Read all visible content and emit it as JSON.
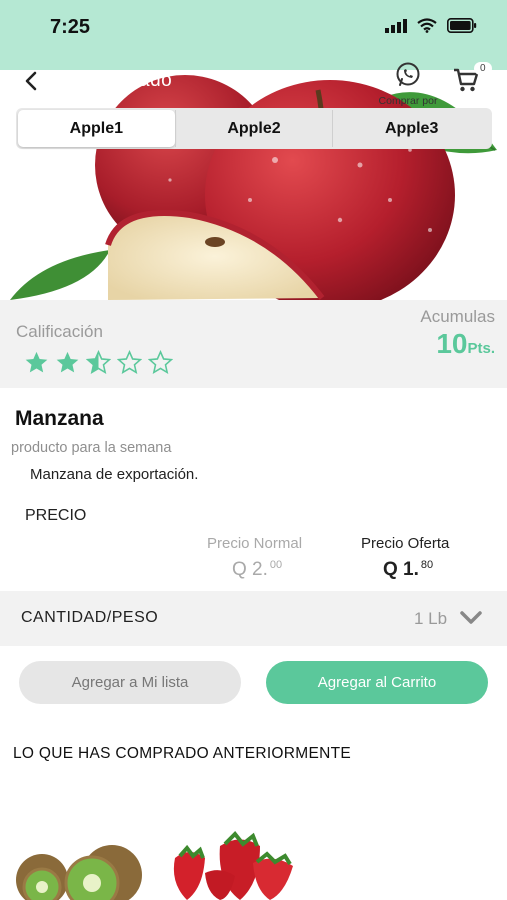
{
  "status_bar": {
    "time": "7:25"
  },
  "header": {
    "title": "Mi mercado",
    "whatsapp_label": "Comprar por",
    "cart_count": "0"
  },
  "tabs": [
    {
      "label": "Apple1",
      "active": true
    },
    {
      "label": "Apple2",
      "active": false
    },
    {
      "label": "Apple3",
      "active": false
    }
  ],
  "rating": {
    "label": "Calificación",
    "value": 2.5,
    "max": 5
  },
  "points": {
    "label": "Acumulas",
    "value": "10",
    "unit": "Pts."
  },
  "product": {
    "name": "Manzana",
    "subtitle": "producto para la semana",
    "description": "Manzana de exportación."
  },
  "pricing": {
    "section_label": "PRECIO",
    "normal_label": "Precio Normal",
    "normal_main": "Q 2.",
    "normal_cents": "00",
    "offer_label": "Precio Oferta",
    "offer_main": "Q 1.",
    "offer_cents": "80"
  },
  "quantity": {
    "label": "CANTIDAD/PESO",
    "value": "1 Lb"
  },
  "actions": {
    "add_to_list": "Agregar a Mi lista",
    "add_to_cart": "Agregar al Carrito"
  },
  "history": {
    "title": "LO QUE HAS COMPRADO ANTERIORMENTE",
    "items": [
      {
        "icon": "kiwi-image"
      },
      {
        "icon": "strawberry-image"
      }
    ]
  },
  "colors": {
    "accent": "#5bc89b",
    "header_bg": "#b5e8d3",
    "section_bg": "#f2f2f2"
  }
}
